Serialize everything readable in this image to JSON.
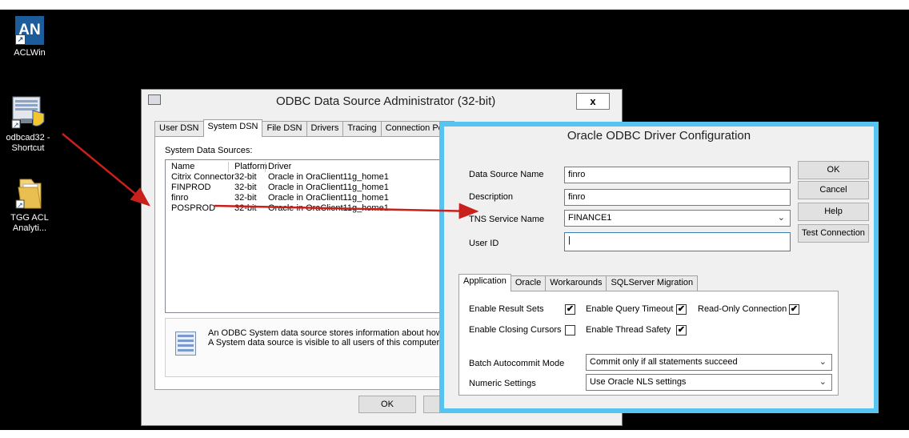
{
  "desktop": {
    "icons": [
      {
        "label": "ACLWin",
        "badge": "AN"
      },
      {
        "label": "odbcad32 - Shortcut"
      },
      {
        "label": "TGG ACL Analyti..."
      }
    ]
  },
  "odbc": {
    "title": "ODBC Data Source Administrator (32-bit)",
    "close": "x",
    "tabs": [
      "User DSN",
      "System DSN",
      "File DSN",
      "Drivers",
      "Tracing",
      "Connection Pool"
    ],
    "section_label": "System Data Sources:",
    "columns": [
      "Name",
      "Platform",
      "Driver"
    ],
    "rows": [
      {
        "name": "Citrix Connector",
        "platform": "32-bit",
        "driver": "Oracle in OraClient11g_home1"
      },
      {
        "name": "FINPROD",
        "platform": "32-bit",
        "driver": "Oracle in OraClient11g_home1"
      },
      {
        "name": "finro",
        "platform": "32-bit",
        "driver": "Oracle in OraClient11g_home1"
      },
      {
        "name": "POSPROD",
        "platform": "32-bit",
        "driver": "Oracle in OraClient11g_home1"
      }
    ],
    "info_line1": "An ODBC System data source stores information about how to",
    "info_line2": "A System data source is visible to all users of this computer, inc",
    "ok_label": "OK"
  },
  "oracle": {
    "title": "Oracle ODBC Driver Configuration",
    "fields": {
      "dsn_label": "Data Source Name",
      "dsn_value": "finro",
      "desc_label": "Description",
      "desc_value": "finro",
      "tns_label": "TNS Service Name",
      "tns_value": "FINANCE1",
      "user_label": "User ID",
      "user_value": ""
    },
    "buttons": {
      "ok": "OK",
      "cancel": "Cancel",
      "help": "Help",
      "test": "Test Connection"
    },
    "tabs": [
      "Application",
      "Oracle",
      "Workarounds",
      "SQLServer Migration"
    ],
    "app": {
      "result_sets": "Enable Result Sets",
      "query_timeout": "Enable Query Timeout",
      "read_only": "Read-Only Connection",
      "closing_cursors": "Enable Closing Cursors",
      "thread_safety": "Enable Thread Safety",
      "checks": {
        "result_sets": true,
        "query_timeout": true,
        "read_only": true,
        "closing_cursors": false,
        "thread_safety": true
      },
      "check_mark": "✔",
      "batch_label": "Batch Autocommit Mode",
      "batch_value": "Commit only if all statements succeed",
      "numeric_label": "Numeric Settings",
      "numeric_value": "Use Oracle NLS settings"
    }
  },
  "annotation_color": "#c8201a"
}
